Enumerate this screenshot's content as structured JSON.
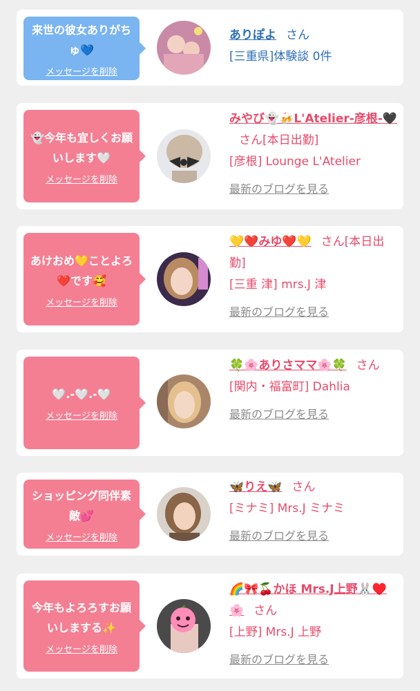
{
  "entries": [
    {
      "theme": "blue",
      "message": "来世の彼女ありがちゅ💙",
      "delete_label": "メッセージを削除",
      "name": "ありぽよ",
      "suffix": "さん",
      "shop": "[三重県]体験談 0件",
      "blog_label": ""
    },
    {
      "theme": "pink",
      "message": "👻今年も宜しくお願いします🤍",
      "delete_label": "メッセージを削除",
      "name": "みやび👻🍻L'Atelier-彦根-🖤",
      "suffix": "さん[本日出勤]",
      "shop": "[彦根] Lounge L'Atelier",
      "blog_label": "最新のブログを見る"
    },
    {
      "theme": "pink",
      "message": "あけおめ💛ことよろ❤️です🥰",
      "delete_label": "メッセージを削除",
      "name": "💛❤️みゆ❤️💛",
      "suffix": "さん[本日出勤]",
      "shop": "[三重 津] mrs.J 津",
      "blog_label": "最新のブログを見る"
    },
    {
      "theme": "pink",
      "message": "🤍.-🤍.-🤍",
      "delete_label": "メッセージを削除",
      "name": "🍀🌸ありさママ🌸🍀",
      "suffix": "さん",
      "shop": "[関内・福富町] Dahlia",
      "blog_label": "最新のブログを見る"
    },
    {
      "theme": "pink",
      "message": "ショッピング同伴素敵💕",
      "delete_label": "メッセージを削除",
      "name": "🦋りえ🦋",
      "suffix": "さん",
      "shop": "[ミナミ] Mrs.J ミナミ",
      "blog_label": "最新のブログを見る"
    },
    {
      "theme": "pink",
      "message": "今年もよろろすお願いしまする✨",
      "delete_label": "メッセージを削除",
      "name": "🌈🎀🍒かほ Mrs.J上野🐰♥️🌸",
      "suffix": "さん",
      "shop": "[上野] Mrs.J 上野",
      "blog_label": "最新のブログを見る"
    }
  ]
}
